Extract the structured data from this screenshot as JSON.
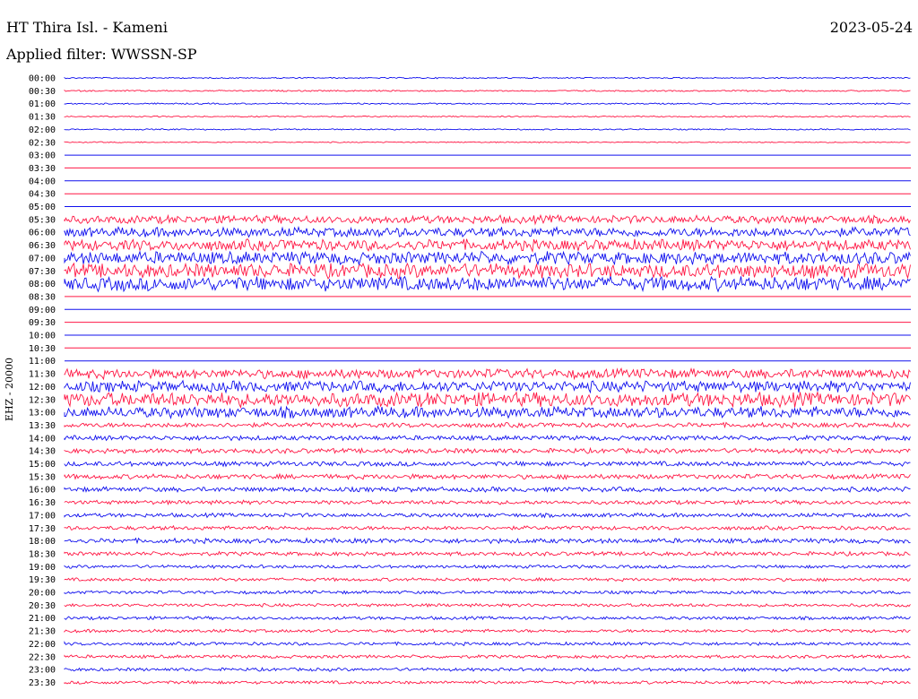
{
  "header": {
    "title": "HT Thira Isl. - Kameni",
    "filter": "Applied filter: WWSSN-SP",
    "date": "2023-05-24"
  },
  "colors": {
    "trace_a": "#1010ee",
    "trace_b": "#ff1744"
  },
  "chart_data": {
    "type": "line",
    "title": "HT Thira Isl. - Kameni",
    "subtitle": "Applied filter: WWSSN-SP",
    "date": "2023-05-24",
    "ylabel": "EHZ - 20000",
    "row_labels": [
      "00:00",
      "00:30",
      "01:00",
      "01:30",
      "02:00",
      "02:30",
      "03:00",
      "03:30",
      "04:00",
      "04:30",
      "05:00",
      "05:30",
      "06:00",
      "06:30",
      "07:00",
      "07:30",
      "08:00",
      "08:30",
      "09:00",
      "09:30",
      "10:00",
      "10:30",
      "11:00",
      "11:30",
      "12:00",
      "12:30",
      "13:00",
      "13:30",
      "14:00",
      "14:30",
      "15:00",
      "15:30",
      "16:00",
      "16:30",
      "17:00",
      "17:30",
      "18:00",
      "18:30",
      "19:00",
      "19:30",
      "20:00",
      "20:30",
      "21:00",
      "21:30",
      "22:00",
      "22:30",
      "23:00",
      "23:30"
    ],
    "series_colors": [
      "blue",
      "red"
    ],
    "row_activity": [
      0.8,
      0.9,
      0.9,
      0.8,
      0.8,
      0.7,
      0,
      0,
      0,
      0,
      0,
      5,
      6,
      7,
      8,
      9,
      9,
      0,
      0,
      0,
      0,
      0,
      0,
      6,
      7,
      9,
      7,
      3,
      3,
      3,
      3,
      3,
      3,
      2.5,
      2.5,
      2.5,
      3,
      2.5,
      2,
      2,
      2,
      2,
      2,
      2,
      2,
      2,
      2,
      2
    ],
    "grid": true
  }
}
